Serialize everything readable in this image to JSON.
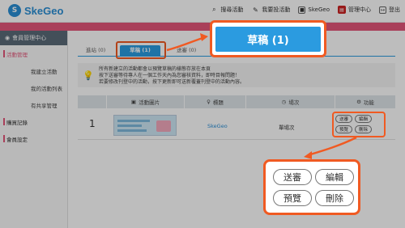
{
  "header": {
    "logo_text": "SkeGeo",
    "nav": [
      {
        "label": "搜尋活動",
        "icon": "search-icon"
      },
      {
        "label": "我要投活動",
        "icon": "pencil-icon"
      },
      {
        "label": "SkeGeo",
        "icon": "square-icon"
      },
      {
        "label": "管理中心",
        "icon": "admin-icon"
      },
      {
        "label": "登出",
        "icon": "logout-icon"
      }
    ]
  },
  "sidebar": {
    "title": "會員管理中心",
    "items": [
      {
        "label": "活動管理",
        "level": 1
      },
      {
        "label": "我建立活動",
        "level": 2
      },
      {
        "label": "我的活動列表",
        "level": 2
      },
      {
        "label": "有共享管理",
        "level": 2
      },
      {
        "label": "購買記錄",
        "level": 1
      },
      {
        "label": "會員設定",
        "level": 1
      }
    ]
  },
  "tabs": [
    {
      "label": "進站 (0)"
    },
    {
      "label": "草稿 (1)"
    },
    {
      "label": "送審 (0)"
    }
  ],
  "notice": {
    "lines": [
      "所有新建立的活動都會以預覽草稿的樣態存放在本頁",
      "按下送審等待專人在一個工作天內為您審核資料，即時目報問題！",
      "若要修改刊登中的活動，按下更新即可送新覆蓋刊登中的活動內容。"
    ]
  },
  "table": {
    "headers": [
      {
        "label": "",
        "icon": ""
      },
      {
        "label": "活動圖片",
        "icon": "image-icon"
      },
      {
        "label": "標題",
        "icon": "bulb-icon"
      },
      {
        "label": "場次",
        "icon": "clock-icon"
      },
      {
        "label": "功能",
        "icon": "gear-icon"
      }
    ],
    "rows": [
      {
        "index": "1",
        "title": "SkeGeo",
        "sessions": "單場次",
        "actions": [
          "送審",
          "編輯",
          "預覽",
          "刪除"
        ]
      }
    ]
  },
  "callouts": {
    "tab_zoom_label": "草稿 (1)",
    "actions_zoom": [
      "送審",
      "編輯",
      "預覽",
      "刪除"
    ]
  },
  "colors": {
    "accent_blue": "#2b9be0",
    "brand_pink": "#e4567a",
    "highlight_orange": "#f05a22"
  }
}
